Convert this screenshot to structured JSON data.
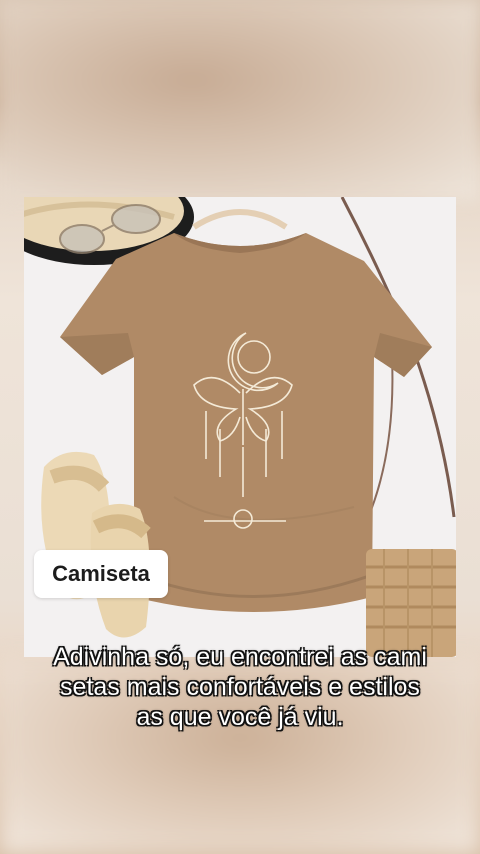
{
  "label": {
    "text": "Camiseta"
  },
  "caption": {
    "lines": [
      "Adivinha só, eu encontrei as cami",
      "setas mais confortáveis e estilos",
      "as que você já viu."
    ]
  },
  "colors": {
    "shirt": "#b08a66",
    "print": "#f4ead7",
    "background": "#f3f1f1",
    "caption_text": "#ffffff"
  }
}
